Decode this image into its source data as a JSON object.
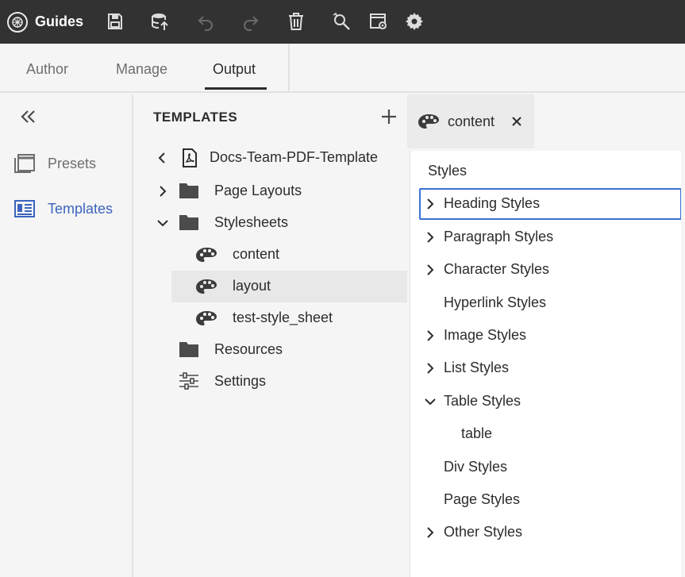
{
  "app": {
    "title": "Guides"
  },
  "toolbar": {
    "icons": [
      "save-icon",
      "database-upload-icon",
      "undo-icon",
      "redo-icon",
      "trash-icon",
      "find-replace-icon",
      "window-settings-icon",
      "gear-icon"
    ]
  },
  "tabs": [
    {
      "label": "Author",
      "active": false
    },
    {
      "label": "Manage",
      "active": false
    },
    {
      "label": "Output",
      "active": true
    }
  ],
  "rail": {
    "items": [
      {
        "label": "Presets",
        "icon": "presets-icon",
        "active": false
      },
      {
        "label": "Templates",
        "icon": "templates-icon",
        "active": true
      }
    ]
  },
  "templates": {
    "title": "TEMPLATES",
    "root": "Docs-Team-PDF-Template",
    "items": [
      {
        "label": "Page Layouts",
        "type": "folder",
        "expanded": false
      },
      {
        "label": "Stylesheets",
        "type": "folder",
        "expanded": true
      },
      {
        "label": "content",
        "type": "stylesheet"
      },
      {
        "label": "layout",
        "type": "stylesheet",
        "selected": true
      },
      {
        "label": "test-style_sheet",
        "type": "stylesheet"
      },
      {
        "label": "Resources",
        "type": "folder"
      },
      {
        "label": "Settings",
        "type": "settings"
      }
    ]
  },
  "editor": {
    "tab_label": "content",
    "styles_heading": "Styles",
    "styles": [
      {
        "label": "Heading Styles",
        "chevron": "right",
        "focused": true
      },
      {
        "label": "Paragraph Styles",
        "chevron": "right"
      },
      {
        "label": "Character Styles",
        "chevron": "right"
      },
      {
        "label": "Hyperlink Styles",
        "chevron": "none"
      },
      {
        "label": "Image Styles",
        "chevron": "right"
      },
      {
        "label": "List Styles",
        "chevron": "right"
      },
      {
        "label": "Table Styles",
        "chevron": "down"
      },
      {
        "label": "table",
        "chevron": "none",
        "child": true
      },
      {
        "label": "Div Styles",
        "chevron": "none"
      },
      {
        "label": "Page Styles",
        "chevron": "none"
      },
      {
        "label": "Other Styles",
        "chevron": "right"
      }
    ]
  },
  "colors": {
    "topbar": "#323232",
    "accent": "#3b63bf",
    "focus": "#3b73d6"
  }
}
